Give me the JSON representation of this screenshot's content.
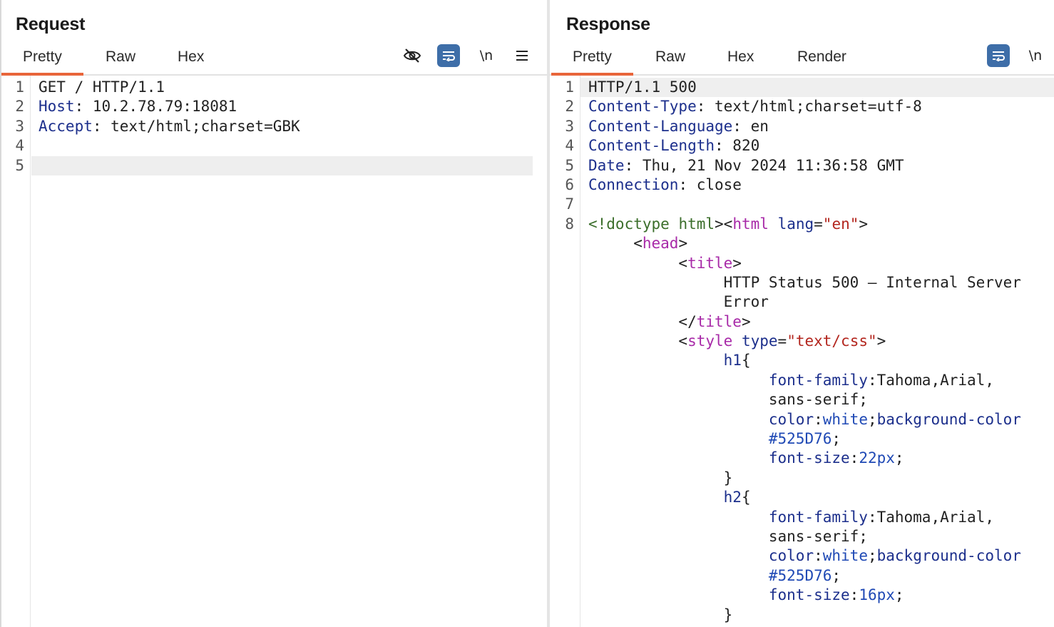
{
  "request": {
    "title": "Request",
    "tabs": [
      "Pretty",
      "Raw",
      "Hex"
    ],
    "active_tab": "Pretty",
    "toolbar": {
      "newline_label": "\\n"
    },
    "line_numbers": [
      "1",
      "2",
      "3",
      "4",
      "5"
    ],
    "lines": [
      [
        {
          "c": "p",
          "t": "GET / HTTP/1.1"
        }
      ],
      [
        {
          "c": "k",
          "t": "Host"
        },
        {
          "c": "p",
          "t": ": 10.2.78.79:18081"
        }
      ],
      [
        {
          "c": "k",
          "t": "Accept"
        },
        {
          "c": "p",
          "t": ": text/html;charset=GBK"
        }
      ],
      [],
      []
    ]
  },
  "response": {
    "title": "Response",
    "tabs": [
      "Pretty",
      "Raw",
      "Hex",
      "Render"
    ],
    "active_tab": "Pretty",
    "toolbar": {
      "newline_label": "\\n"
    },
    "line_numbers": [
      "1",
      "2",
      "3",
      "4",
      "5",
      "6",
      "7",
      "8",
      "",
      "",
      "",
      "",
      "",
      "",
      "",
      "",
      "",
      "",
      "",
      "",
      "",
      "",
      "",
      "",
      "",
      "",
      ""
    ],
    "lines": [
      [
        {
          "c": "p",
          "t": "HTTP/1.1 500"
        }
      ],
      [
        {
          "c": "k",
          "t": "Content-Type"
        },
        {
          "c": "p",
          "t": ": text/html;charset=utf-8"
        }
      ],
      [
        {
          "c": "k",
          "t": "Content-Language"
        },
        {
          "c": "p",
          "t": ": en"
        }
      ],
      [
        {
          "c": "k",
          "t": "Content-Length"
        },
        {
          "c": "p",
          "t": ": 820"
        }
      ],
      [
        {
          "c": "k",
          "t": "Date"
        },
        {
          "c": "p",
          "t": ": Thu, 21 Nov 2024 11:36:58 GMT"
        }
      ],
      [
        {
          "c": "k",
          "t": "Connection"
        },
        {
          "c": "p",
          "t": ": close"
        }
      ],
      [],
      [
        {
          "c": "d",
          "t": "<!doctype"
        },
        {
          "c": "p",
          "t": " "
        },
        {
          "c": "d",
          "t": "html"
        },
        {
          "c": "p",
          "t": "><"
        },
        {
          "c": "t",
          "t": "html"
        },
        {
          "c": "p",
          "t": " "
        },
        {
          "c": "a",
          "t": "lang"
        },
        {
          "c": "p",
          "t": "="
        },
        {
          "c": "s",
          "t": "\"en\""
        },
        {
          "c": "p",
          "t": ">"
        }
      ],
      [
        {
          "c": "p",
          "t": "     <"
        },
        {
          "c": "t",
          "t": "head"
        },
        {
          "c": "p",
          "t": ">"
        }
      ],
      [
        {
          "c": "p",
          "t": "          <"
        },
        {
          "c": "t",
          "t": "title"
        },
        {
          "c": "p",
          "t": ">"
        }
      ],
      [
        {
          "c": "p",
          "t": "               HTTP Status 500 – Internal Server"
        }
      ],
      [
        {
          "c": "p",
          "t": "               Error"
        }
      ],
      [
        {
          "c": "p",
          "t": "          </"
        },
        {
          "c": "t",
          "t": "title"
        },
        {
          "c": "p",
          "t": ">"
        }
      ],
      [
        {
          "c": "p",
          "t": "          <"
        },
        {
          "c": "t",
          "t": "style"
        },
        {
          "c": "p",
          "t": " "
        },
        {
          "c": "a",
          "t": "type"
        },
        {
          "c": "p",
          "t": "="
        },
        {
          "c": "s",
          "t": "\"text/css\""
        },
        {
          "c": "p",
          "t": ">"
        }
      ],
      [
        {
          "c": "p",
          "t": "               "
        },
        {
          "c": "k",
          "t": "h1"
        },
        {
          "c": "p",
          "t": "{"
        }
      ],
      [
        {
          "c": "p",
          "t": "                    "
        },
        {
          "c": "k",
          "t": "font-family"
        },
        {
          "c": "p",
          "t": ":Tahoma,Arial,"
        }
      ],
      [
        {
          "c": "p",
          "t": "                    sans-serif;"
        }
      ],
      [
        {
          "c": "p",
          "t": "                    "
        },
        {
          "c": "k",
          "t": "color"
        },
        {
          "c": "p",
          "t": ":"
        },
        {
          "c": "v",
          "t": "white"
        },
        {
          "c": "p",
          "t": ";"
        },
        {
          "c": "k",
          "t": "background-color"
        }
      ],
      [
        {
          "c": "p",
          "t": "                    "
        },
        {
          "c": "v",
          "t": "#525D76"
        },
        {
          "c": "p",
          "t": ";"
        }
      ],
      [
        {
          "c": "p",
          "t": "                    "
        },
        {
          "c": "k",
          "t": "font-size"
        },
        {
          "c": "p",
          "t": ":"
        },
        {
          "c": "v",
          "t": "22px"
        },
        {
          "c": "p",
          "t": ";"
        }
      ],
      [
        {
          "c": "p",
          "t": "               }"
        }
      ],
      [
        {
          "c": "p",
          "t": "               "
        },
        {
          "c": "k",
          "t": "h2"
        },
        {
          "c": "p",
          "t": "{"
        }
      ],
      [
        {
          "c": "p",
          "t": "                    "
        },
        {
          "c": "k",
          "t": "font-family"
        },
        {
          "c": "p",
          "t": ":Tahoma,Arial,"
        }
      ],
      [
        {
          "c": "p",
          "t": "                    sans-serif;"
        }
      ],
      [
        {
          "c": "p",
          "t": "                    "
        },
        {
          "c": "k",
          "t": "color"
        },
        {
          "c": "p",
          "t": ":"
        },
        {
          "c": "v",
          "t": "white"
        },
        {
          "c": "p",
          "t": ";"
        },
        {
          "c": "k",
          "t": "background-color"
        }
      ],
      [
        {
          "c": "p",
          "t": "                    "
        },
        {
          "c": "v",
          "t": "#525D76"
        },
        {
          "c": "p",
          "t": ";"
        }
      ],
      [
        {
          "c": "p",
          "t": "                    "
        },
        {
          "c": "k",
          "t": "font-size"
        },
        {
          "c": "p",
          "t": ":"
        },
        {
          "c": "v",
          "t": "16px"
        },
        {
          "c": "p",
          "t": ";"
        }
      ],
      [
        {
          "c": "p",
          "t": "               }"
        }
      ]
    ]
  },
  "colors": {
    "accent_tab": "#e8653a",
    "button_blue": "#3e6ea8"
  }
}
